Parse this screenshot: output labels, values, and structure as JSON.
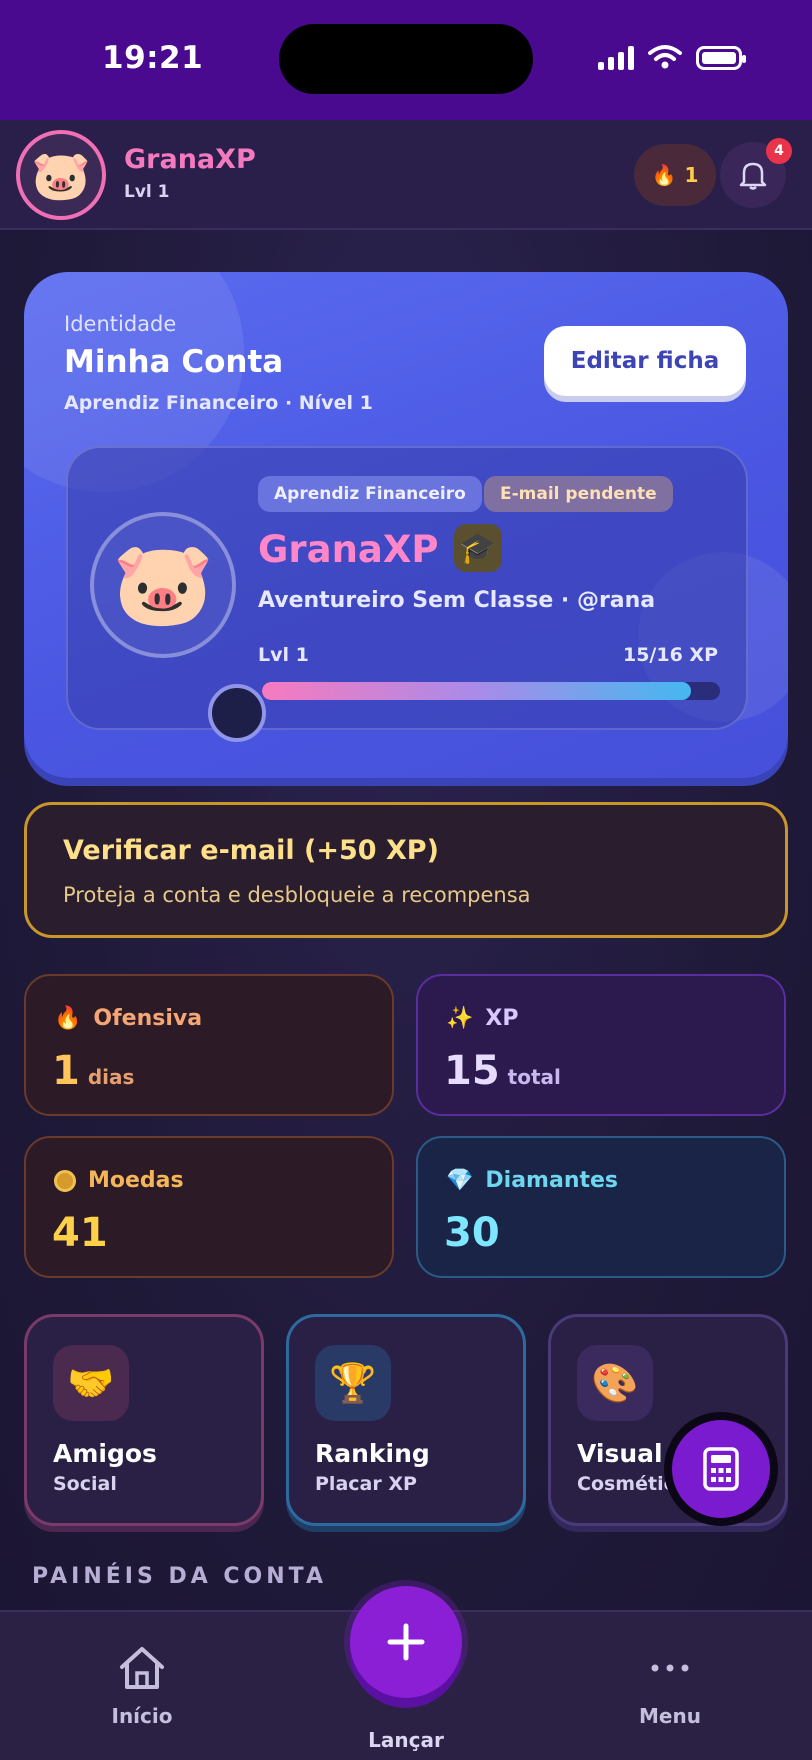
{
  "status_bar": {
    "time": "19:21"
  },
  "header": {
    "app_name": "GranaXP",
    "level": "Lvl 1",
    "streak_count": "1",
    "notification_count": "4"
  },
  "profile": {
    "kicker": "Identidade",
    "title": "Minha Conta",
    "subtitle": "Aprendiz Financeiro · Nível 1",
    "edit_button": "Editar ficha",
    "tags": [
      "Aprendiz Financeiro",
      "E-mail pendente"
    ],
    "name": "GranaXP",
    "class_line": "Aventureiro Sem Classe  ·  @rana",
    "level": "Lvl 1",
    "xp_text": "15/16 XP",
    "xp_progress": 0.9375
  },
  "verify": {
    "title": "Verificar e-mail (+50 XP)",
    "subtitle": "Proteja a conta e desbloqueie a recompensa"
  },
  "stats": {
    "ofensiva": {
      "label": "Ofensiva",
      "value": "1",
      "unit": "dias",
      "icon": "flame-icon"
    },
    "xp": {
      "label": "XP",
      "value": "15",
      "unit": "total",
      "icon": "sparkles-icon"
    },
    "moedas": {
      "label": "Moedas",
      "value": "41",
      "icon": "coin-icon"
    },
    "diamantes": {
      "label": "Diamantes",
      "value": "30",
      "icon": "gem-icon"
    }
  },
  "shortcuts": [
    {
      "title": "Amigos",
      "subtitle": "Social",
      "icon": "handshake-icon"
    },
    {
      "title": "Ranking",
      "subtitle": "Placar XP",
      "icon": "trophy-icon"
    },
    {
      "title": "Visual",
      "subtitle": "Cosmétic",
      "icon": "palette-icon"
    }
  ],
  "section_title": "PAINÉIS DA CONTA",
  "bottom_nav": {
    "home": "Início",
    "add": "Lançar",
    "menu": "Menu"
  },
  "colors": {
    "accent": "#8a1fd6",
    "card": "#5b6cf0",
    "pink": "#f47ac0",
    "gold": "#ffd04a"
  }
}
